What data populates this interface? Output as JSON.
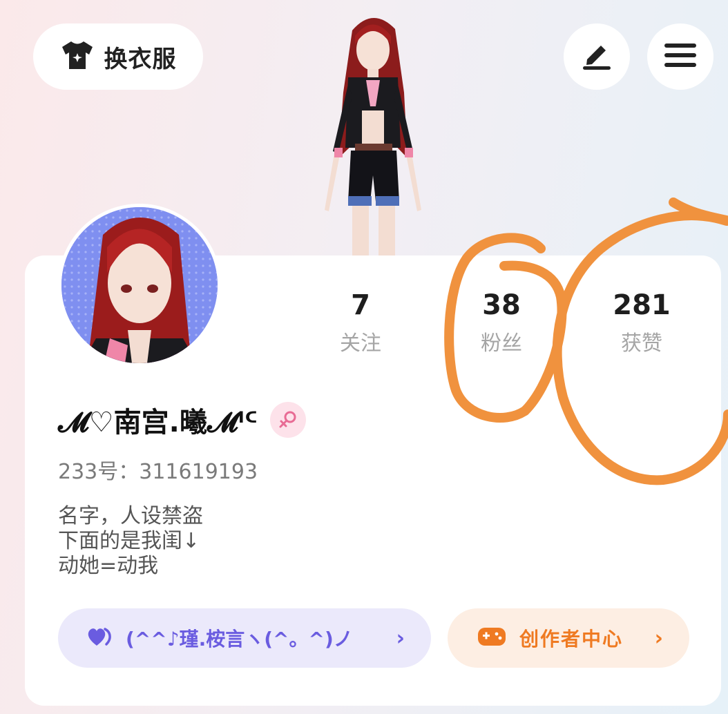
{
  "header": {
    "wardrobe_label": "换衣服",
    "wardrobe_icon": "tshirt-icon",
    "edit_icon": "pen-icon",
    "menu_icon": "hamburger-menu-icon"
  },
  "profile": {
    "nickname": "𝓜♡南宫.曦𝓜ᑊᑦ",
    "gender_icon": "female-icon",
    "uid_label": "233号：311619193",
    "bio": [
      "名字，人设禁盗",
      "下面的是我闺↓",
      "动她=动我"
    ]
  },
  "stats": [
    {
      "value": "7",
      "label": "关注"
    },
    {
      "value": "38",
      "label": "粉丝"
    },
    {
      "value": "281",
      "label": "获赞"
    }
  ],
  "buttons": {
    "friend_label": "(^^♪瑾.桉言ヽ(^。^)ノ",
    "friend_icon": "hearts-icon",
    "creator_label": "创作者中心",
    "creator_icon": "gamepad-icon",
    "chevron": "›"
  },
  "colors": {
    "accent_purple": "#6a5ce0",
    "accent_orange": "#ef7a22",
    "annotation_orange": "#f0923e",
    "pink_badge": "#fde2ea"
  }
}
